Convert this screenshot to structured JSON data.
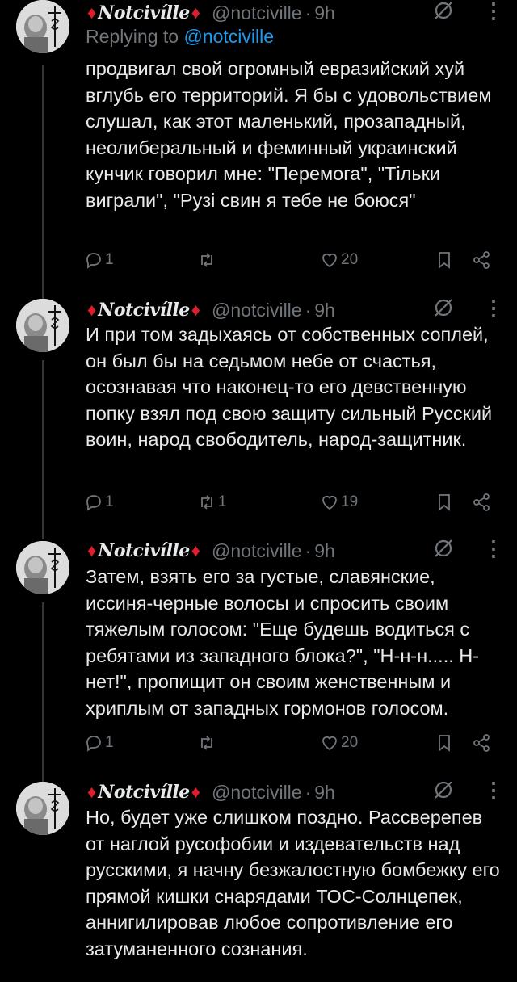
{
  "tweets": [
    {
      "display_name": "Notcivílle",
      "handle": "@notciville",
      "separator": "·",
      "time": "9h",
      "replying_label": "Replying to",
      "replying_handle": "@notciville",
      "text": "продвигал свой огромный евразийский хуй вглубь его территорий. Я бы с удовольствием слушал, как этот маленький, прозападный, неолиберальный и феминный украинский кунчик говорил мне: \"Перемога\", \"Тiльки виграли\", \"Рузi свин я тебе не боюся\"",
      "replies": "1",
      "retweets": "",
      "likes": "20"
    },
    {
      "display_name": "Notcivílle",
      "handle": "@notciville",
      "separator": "·",
      "time": "9h",
      "text": "И при том задыхаясь от собственных соплей, он был бы на седьмом небе от счастья, осознавая что наконец-то его девственную попку взял под свою защиту сильный Русский воин, народ свободитель, народ-защитник.",
      "replies": "1",
      "retweets": "1",
      "likes": "19"
    },
    {
      "display_name": "Notcivílle",
      "handle": "@notciville",
      "separator": "·",
      "time": "9h",
      "text": "Затем, взять его за густые, славянские, иссиня-черные волосы и спросить своим тяжелым голосом: \"Еще будешь водиться с ребятами из западного блока?\", \"Н-н-н..... Н-нет!\", пропищит он своим женственным и хриплым от западных гормонов голосом.",
      "replies": "1",
      "retweets": "",
      "likes": "20"
    },
    {
      "display_name": "Notcivílle",
      "handle": "@notciville",
      "separator": "·",
      "time": "9h",
      "text": "Но, будет уже слишком поздно. Рассверепев от наглой русофобии и издевательств над русскими, я начну безжалостную бомбежку его прямой кишки снарядами ТОС-Солнцепек, аннигилировав любое сопротивление его затуманенного сознания.",
      "replies": "",
      "retweets": "",
      "likes": ""
    }
  ],
  "icons": {
    "reply": "reply-icon",
    "retweet": "retweet-icon",
    "like": "heart-icon",
    "bookmark": "bookmark-icon",
    "share": "share-icon",
    "hide": "hide-reply-icon",
    "more": "more-icon"
  },
  "colors": {
    "background": "#000000",
    "text": "#e7e9ea",
    "muted": "#71767b",
    "link": "#1d9bf0",
    "diamond": "#e01e2b"
  }
}
